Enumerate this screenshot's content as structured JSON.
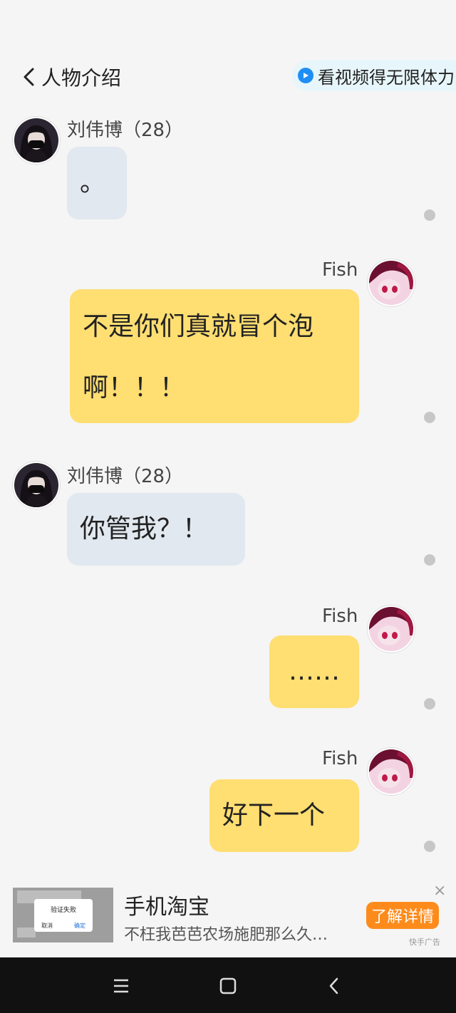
{
  "header": {
    "back_label": "人物介绍",
    "promo_label": "看视频得无限体力"
  },
  "messages": [
    {
      "sender": "刘伟博（28）",
      "side": "them",
      "text": "。"
    },
    {
      "sender": "Fish",
      "side": "me",
      "text_line1": "不是你们真就冒个泡",
      "text_line2": "啊！！！"
    },
    {
      "sender": "刘伟博（28）",
      "side": "them",
      "text": "你管我？！"
    },
    {
      "sender": "Fish",
      "side": "me",
      "text": "……"
    },
    {
      "sender": "Fish",
      "side": "me",
      "text": "好下一个"
    }
  ],
  "ad": {
    "title": "手机淘宝",
    "description": "不枉我芭芭农场施肥那么久…",
    "cta_label": "了解详情",
    "close_label": "×",
    "source": "快手广告",
    "thumb_dialog_title": "验证失败",
    "thumb_dialog_cancel": "取消",
    "thumb_dialog_ok": "确定"
  },
  "icons": {
    "back": "chevron-left-icon",
    "promo": "play-icon",
    "nav": [
      "menu-icon",
      "home-square-icon",
      "back-triangle-icon"
    ]
  },
  "colors": {
    "bubble_them": "#e2e8f0",
    "bubble_me": "#ffde72",
    "cta": "#fd8b1c",
    "promo_bg": "#e7f6fa"
  }
}
